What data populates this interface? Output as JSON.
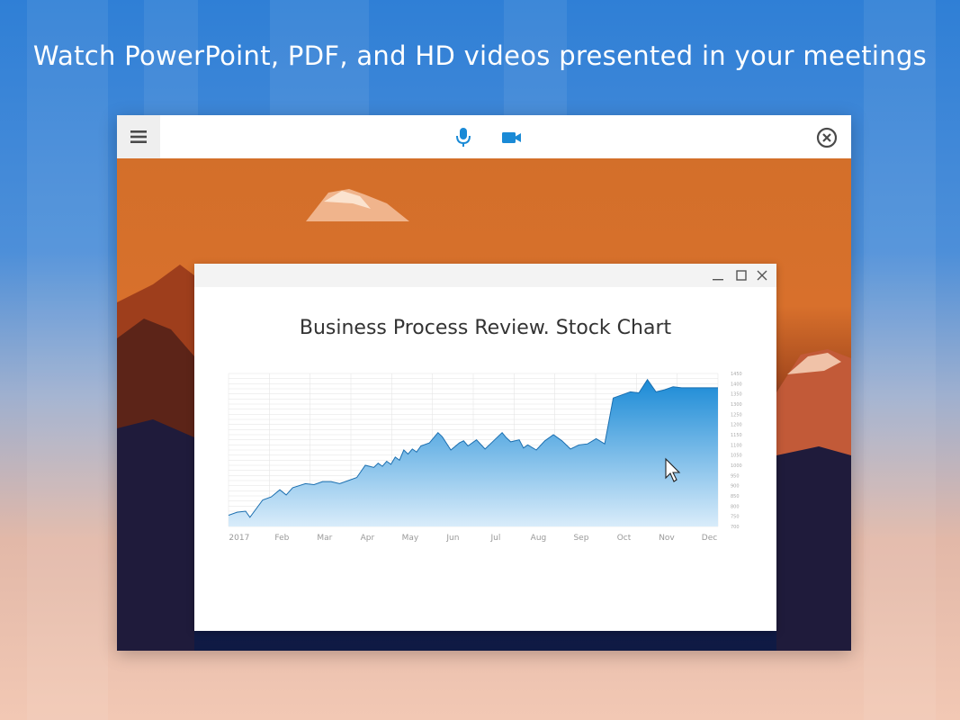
{
  "headline": "Watch PowerPoint, PDF, and HD videos presented in your meetings",
  "toolbar": {
    "menu_icon": "hamburger-icon",
    "mic_icon": "microphone-icon",
    "camera_icon": "video-camera-icon",
    "close_icon": "close-circle-icon",
    "accent": "#1a8ad6"
  },
  "window_controls": {
    "minimize_icon": "minimize-icon",
    "maximize_icon": "maximize-icon",
    "close_icon": "close-icon"
  },
  "slide": {
    "title": "Business Process Review. Stock Chart"
  },
  "chart_data": {
    "type": "area",
    "title": "Business Process Review. Stock Chart",
    "xlabel": "",
    "ylabel": "",
    "x_ticks": [
      "2017",
      "Feb",
      "Mar",
      "Apr",
      "May",
      "Jun",
      "Jul",
      "Aug",
      "Sep",
      "Oct",
      "Nov",
      "Dec"
    ],
    "y_ticks": [
      700,
      750,
      800,
      850,
      900,
      950,
      1000,
      1050,
      1100,
      1150,
      1200,
      1250,
      1300,
      1350,
      1400,
      1450
    ],
    "ylim": [
      700,
      1450
    ],
    "grid": true,
    "series": [
      {
        "x": [
          0,
          0.2,
          0.4,
          0.5,
          0.8,
          1.0,
          1.2,
          1.35,
          1.5,
          1.8,
          2.0,
          2.2,
          2.4,
          2.6,
          2.8,
          3.0,
          3.2,
          3.4,
          3.5,
          3.6,
          3.7,
          3.8,
          3.9,
          4.0,
          4.1,
          4.2,
          4.3,
          4.4,
          4.5,
          4.7,
          4.9,
          5.0,
          5.2,
          5.4,
          5.5,
          5.6,
          5.8,
          6.0,
          6.2,
          6.4,
          6.5,
          6.6,
          6.8,
          6.9,
          7.0,
          7.2,
          7.4,
          7.6,
          7.8,
          8.0,
          8.2,
          8.4,
          8.6,
          8.8,
          9.0,
          9.2,
          9.4,
          9.6,
          9.8,
          10.0,
          10.2,
          10.4,
          10.6,
          10.8,
          11.0,
          11.2,
          11.45
        ],
        "values": [
          755,
          770,
          775,
          745,
          830,
          845,
          880,
          855,
          890,
          910,
          905,
          920,
          920,
          910,
          925,
          940,
          1000,
          990,
          1010,
          995,
          1020,
          1005,
          1040,
          1025,
          1075,
          1055,
          1080,
          1065,
          1095,
          1110,
          1160,
          1140,
          1075,
          1110,
          1120,
          1095,
          1125,
          1080,
          1120,
          1160,
          1135,
          1115,
          1125,
          1085,
          1100,
          1075,
          1120,
          1150,
          1120,
          1080,
          1100,
          1105,
          1130,
          1105,
          1330,
          1345,
          1360,
          1355,
          1420,
          1360,
          1370,
          1385,
          1380,
          1380,
          1380,
          1380,
          1380
        ],
        "color": "#1a8ad6"
      }
    ]
  }
}
